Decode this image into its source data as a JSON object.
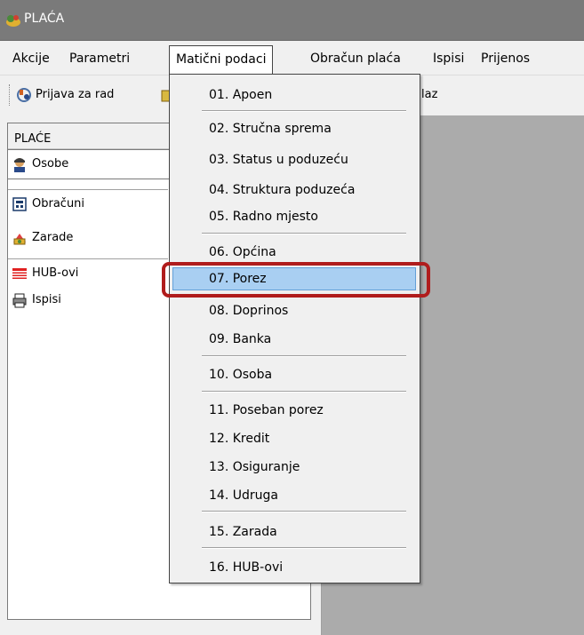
{
  "window": {
    "title": "PLAĆA",
    "icon": "app-icon"
  },
  "menubar": {
    "items": [
      "Akcije",
      "Parametri",
      "Matični podaci",
      "Obračun plaća",
      "Ispisi",
      "Prijenos"
    ],
    "active": "Matični podaci"
  },
  "toolbar": {
    "prijava_label": "Prijava za rad",
    "izlaz_partial": "laz"
  },
  "side_panel": {
    "header": "PLAĆE",
    "items": [
      {
        "label": "Osobe",
        "icon": "person-icon"
      },
      {
        "label": "Obračuni",
        "icon": "calculator-icon"
      },
      {
        "label": "Zarade",
        "icon": "money-icon"
      },
      {
        "label": "HUB-ovi",
        "icon": "hub-icon"
      },
      {
        "label": "Ispisi",
        "icon": "printer-icon"
      }
    ]
  },
  "dropdown": {
    "items": [
      "01. Apoen",
      "02. Stručna sprema",
      "03. Status u poduzeću",
      "04. Struktura poduzeća",
      "05. Radno mjesto",
      "06. Općina",
      "07. Porez",
      "08. Doprinos",
      "09. Banka",
      "10. Osoba",
      "11. Poseban porez",
      "12. Kredit",
      "13. Osiguranje",
      "14. Udruga",
      "15. Zarada",
      "16. HUB-ovi"
    ],
    "hovered": "07. Porez"
  },
  "colors": {
    "highlight_border": "#b01c1c",
    "hover_bg": "#a9cff2",
    "titlebar": "#7a7a7a",
    "workspace": "#ababab"
  }
}
